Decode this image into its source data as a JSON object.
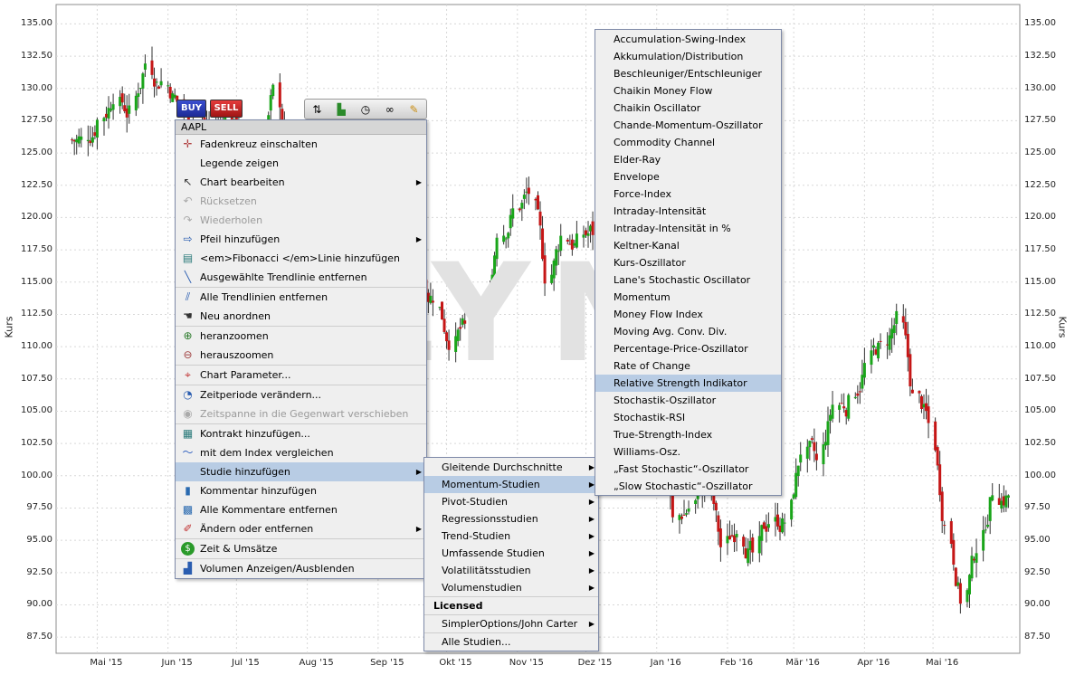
{
  "chart": {
    "symbol": "AAPL",
    "y_axis_label": "Kurs",
    "watermark": "LYNX",
    "buy_label": "BUY",
    "sell_label": "SELL",
    "toolbar_icons": [
      "trade-arrows-icon",
      "bar-chart-icon",
      "clock-icon",
      "link-icon",
      "brush-icon"
    ],
    "y_ticks": [
      "135.00",
      "132.50",
      "130.00",
      "127.50",
      "125.00",
      "122.50",
      "120.00",
      "117.50",
      "115.00",
      "112.50",
      "110.00",
      "107.50",
      "105.00",
      "102.50",
      "100.00",
      "97.50",
      "95.00",
      "92.50",
      "90.00",
      "87.50"
    ],
    "x_ticks": [
      "Mai '15",
      "Jun '15",
      "Jul '15",
      "Aug '15",
      "Sep '15",
      "Okt '15",
      "Nov '15",
      "Dez '15",
      "Jan '16",
      "Feb '16",
      "Mär '16",
      "Apr '16",
      "Mai '16"
    ],
    "colors": {
      "up": "#1aa51a",
      "down": "#c51616",
      "grid": "#d8d8d8"
    }
  },
  "chart_data": {
    "type": "candlestick",
    "ylim": [
      86.25,
      136.5
    ],
    "xlabel": "",
    "ylabel": "Kurs",
    "grid": true,
    "x": [
      "2015-04-20",
      "2015-04-27",
      "2015-05-04",
      "2015-05-11",
      "2015-05-18",
      "2015-05-25",
      "2015-06-01",
      "2015-06-08",
      "2015-06-15",
      "2015-06-22",
      "2015-06-29",
      "2015-07-06",
      "2015-07-13",
      "2015-07-20",
      "2015-07-27",
      "2015-08-03",
      "2015-08-10",
      "2015-08-17",
      "2015-08-24",
      "2015-08-31",
      "2015-09-07",
      "2015-09-14",
      "2015-09-21",
      "2015-09-28",
      "2015-10-05",
      "2015-10-12",
      "2015-10-19",
      "2015-10-26",
      "2015-11-02",
      "2015-11-09",
      "2015-11-16",
      "2015-11-23",
      "2015-11-30",
      "2015-12-07",
      "2015-12-14",
      "2015-12-21",
      "2015-12-28",
      "2016-01-04",
      "2016-01-11",
      "2016-01-18",
      "2016-01-25",
      "2016-02-01",
      "2016-02-08",
      "2016-02-15",
      "2016-02-22",
      "2016-02-29",
      "2016-03-07",
      "2016-03-14",
      "2016-03-21",
      "2016-03-28",
      "2016-04-04",
      "2016-04-11",
      "2016-04-18",
      "2016-04-25",
      "2016-05-02",
      "2016-05-09",
      "2016-05-16",
      "2016-05-23",
      "2016-05-30"
    ],
    "close": [
      126.0,
      127.5,
      129.5,
      128.0,
      132.0,
      130.5,
      129.0,
      127.2,
      127.0,
      127.5,
      126.5,
      125.0,
      129.8,
      124.5,
      122.0,
      115.5,
      116.0,
      106.0,
      112.0,
      110.0,
      114.0,
      115.5,
      114.0,
      110.5,
      111.5,
      111.0,
      119.0,
      120.5,
      122.0,
      115.5,
      118.5,
      118.0,
      119.0,
      113.0,
      109.0,
      108.0,
      105.0,
      96.5,
      97.5,
      99.5,
      94.5,
      96.0,
      94.0,
      96.5,
      96.5,
      102.0,
      101.0,
      105.5,
      105.5,
      108.5,
      110.0,
      112.0,
      106.0,
      104.0,
      96.0,
      90.5,
      94.5,
      99.0,
      98.5
    ]
  },
  "context_menu": {
    "title": "AAPL",
    "items": [
      {
        "label": "Fadenkreuz einschalten",
        "icon": "crosshair-icon",
        "name": "menu-item-crosshair"
      },
      {
        "label": "Legende zeigen",
        "icon": "",
        "name": "menu-item-legend"
      },
      {
        "label": "Chart bearbeiten",
        "icon": "pointer-icon",
        "name": "menu-item-edit-chart",
        "submenu": true
      },
      {
        "label": "Rücksetzen",
        "icon": "undo-icon",
        "name": "menu-item-reset",
        "disabled": true
      },
      {
        "label": "Wiederholen",
        "icon": "redo-icon",
        "name": "menu-item-redo",
        "disabled": true
      },
      {
        "label": "Pfeil hinzufügen",
        "icon": "arrow-icon",
        "name": "menu-item-add-arrow",
        "submenu": true
      },
      {
        "label": "<em>Fibonacci </em>Linie hinzufügen",
        "icon": "fibonacci-icon",
        "name": "menu-item-fibonacci"
      },
      {
        "label": "Ausgewählte Trendlinie entfernen",
        "icon": "trendline-icon",
        "name": "menu-item-remove-trendline"
      },
      {
        "label": "Alle Trendlinien entfernen",
        "icon": "trendlines-icon",
        "name": "menu-item-remove-all-trendlines",
        "sep": true
      },
      {
        "label": "Neu anordnen",
        "icon": "hand-icon",
        "name": "menu-item-rearrange"
      },
      {
        "label": "heranzoomen",
        "icon": "zoom-in-icon",
        "name": "menu-item-zoom-in",
        "sep": true
      },
      {
        "label": "herauszoomen",
        "icon": "zoom-out-icon",
        "name": "menu-item-zoom-out"
      },
      {
        "label": "Chart Parameter...",
        "icon": "target-icon",
        "name": "menu-item-chart-parameters",
        "sep": true
      },
      {
        "label": "Zeitperiode verändern...",
        "icon": "time-period-icon",
        "name": "menu-item-change-period",
        "sep": true
      },
      {
        "label": "Zeitspanne in die Gegenwart verschieben",
        "icon": "shift-time-icon",
        "name": "menu-item-shift-to-present",
        "disabled": true
      },
      {
        "label": "Kontrakt hinzufügen...",
        "icon": "add-contract-icon",
        "name": "menu-item-add-contract",
        "sep": true
      },
      {
        "label": "mit dem Index vergleichen",
        "icon": "compare-index-icon",
        "name": "menu-item-compare-index"
      },
      {
        "label": "Studie hinzufügen",
        "icon": "",
        "name": "menu-item-add-study",
        "submenu": true,
        "selected": true
      },
      {
        "label": "Kommentar hinzufügen",
        "icon": "comment-icon",
        "name": "menu-item-add-comment"
      },
      {
        "label": "Alle Kommentare entfernen",
        "icon": "remove-comments-icon",
        "name": "menu-item-remove-comments"
      },
      {
        "label": "Ändern oder entfernen",
        "icon": "pencil-icon",
        "name": "menu-item-modify-remove",
        "submenu": true
      },
      {
        "label": "Zeit & Umsätze",
        "icon": "dollar-icon",
        "name": "menu-item-time-sales",
        "sep": true
      },
      {
        "label": "Volumen Anzeigen/Ausblenden",
        "icon": "volume-icon",
        "name": "menu-item-toggle-volume",
        "sep": true
      }
    ]
  },
  "studies_menu": {
    "items": [
      {
        "label": "Gleitende Durchschnitte",
        "submenu": true
      },
      {
        "label": "Momentum-Studien",
        "submenu": true,
        "selected": true
      },
      {
        "label": "Pivot-Studien",
        "submenu": true
      },
      {
        "label": "Regressionsstudien",
        "submenu": true
      },
      {
        "label": "Trend-Studien",
        "submenu": true
      },
      {
        "label": "Umfassende Studien",
        "submenu": true
      },
      {
        "label": "Volatilitätsstudien",
        "submenu": true
      },
      {
        "label": "Volumenstudien",
        "submenu": true
      },
      {
        "label": "Licensed",
        "group": true
      },
      {
        "label": "SimplerOptions/John Carter",
        "submenu": true,
        "sep": true
      },
      {
        "label": "Alle Studien...",
        "sep": true
      }
    ]
  },
  "momentum_menu": {
    "items": [
      "Accumulation-Swing-Index",
      "Akkumulation/Distribution",
      "Beschleuniger/Entschleuniger",
      "Chaikin Money Flow",
      "Chaikin Oscillator",
      "Chande-Momentum-Oszillator",
      "Commodity Channel",
      "Elder-Ray",
      "Envelope",
      "Force-Index",
      "Intraday-Intensität",
      "Intraday-Intensität in %",
      "Keltner-Kanal",
      "Kurs-Oszillator",
      "Lane's Stochastic Oscillator",
      "Momentum",
      "Money Flow Index",
      "Moving Avg. Conv. Div.",
      "Percentage-Price-Oszillator",
      "Rate of Change",
      "Relative Strength Indikator",
      "Stochastik-Oszillator",
      "Stochastik-RSI",
      "True-Strength-Index",
      "Williams-Osz.",
      "„Fast Stochastic“-Oszillator",
      "„Slow Stochastic“-Oszillator"
    ],
    "selected_index": 20
  }
}
